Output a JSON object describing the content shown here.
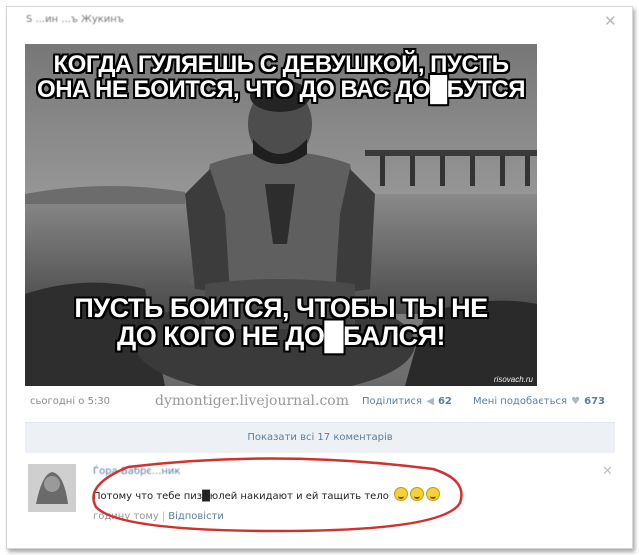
{
  "post": {
    "author": "Ѕ ...ин ...ъ Жукинъ",
    "close_glyph": "✕",
    "meme": {
      "top_line1": "КОГДА ГУЛЯЕШЬ С ДЕВУШКОЙ, ПУСТЬ",
      "top_line2": "ОНА НЕ БОИТСЯ, ЧТО ДО ВАС ДО█БУТСЯ",
      "bottom_line1": "ПУСТЬ БОИТСЯ, ЧТОБЫ ТЫ НЕ",
      "bottom_line2": "ДО КОГО НЕ ДО█БАЛСЯ!",
      "watermark": "risovach.ru"
    },
    "time": "сьогодні о 5:30",
    "domain": "dymontiger.livejournal.com",
    "share_label": "Поділитися",
    "share_count": "62",
    "like_label": "Мені подобається",
    "like_count": "673"
  },
  "comments": {
    "show_all_label": "Показати всі 17 коментарів",
    "items": [
      {
        "author": "Ѓора Бабрє...ник",
        "text": "Потому что тебе пиз█юлей накидают и ей тащить тело",
        "time": "годину тому",
        "reply_label": "Відповісти",
        "close_glyph": "✕"
      }
    ]
  },
  "colors": {
    "link": "#5b7ea0",
    "highlight_ellipse": "#d0322e",
    "comments_bar": "#edf1f5"
  },
  "icons": {
    "share": "megaphone-icon",
    "like": "heart-icon",
    "close": "close-icon"
  }
}
